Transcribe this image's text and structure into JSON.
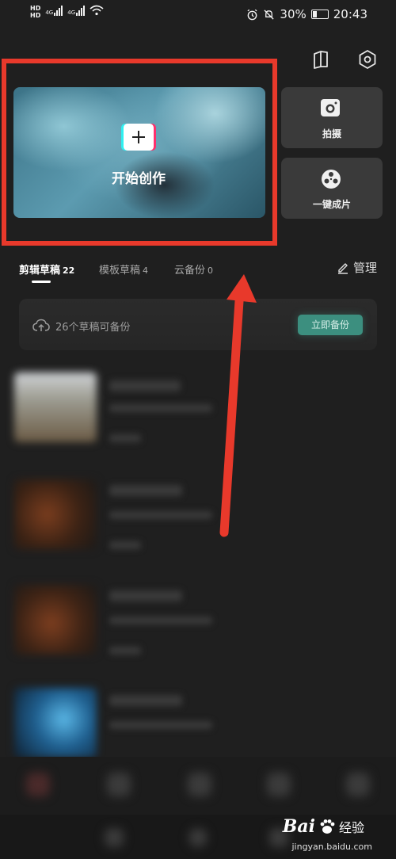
{
  "status_bar": {
    "hd1": "HD",
    "hd2": "HD",
    "net1": "4G",
    "net2": "4G",
    "battery": "30%",
    "time": "20:43"
  },
  "create": {
    "label": "开始创作"
  },
  "actions": [
    {
      "label": "拍摄",
      "icon": "camera-icon"
    },
    {
      "label": "一键成片",
      "icon": "film-reel-icon"
    }
  ],
  "tabs": [
    {
      "label": "剪辑草稿",
      "count": "22",
      "active": true
    },
    {
      "label": "模板草稿",
      "count": "4",
      "active": false
    },
    {
      "label": "云备份",
      "count": "0",
      "active": false
    }
  ],
  "manage": {
    "label": "管理"
  },
  "backup": {
    "text": "26个草稿可备份",
    "button": "立即备份"
  },
  "watermark": {
    "brand": "Bai",
    "brand_suffix": "经验",
    "url": "jingyan.baidu.com"
  },
  "colors": {
    "highlight": "#e8392b",
    "accent": "#3c8f7f",
    "background": "#1f1f1f"
  }
}
